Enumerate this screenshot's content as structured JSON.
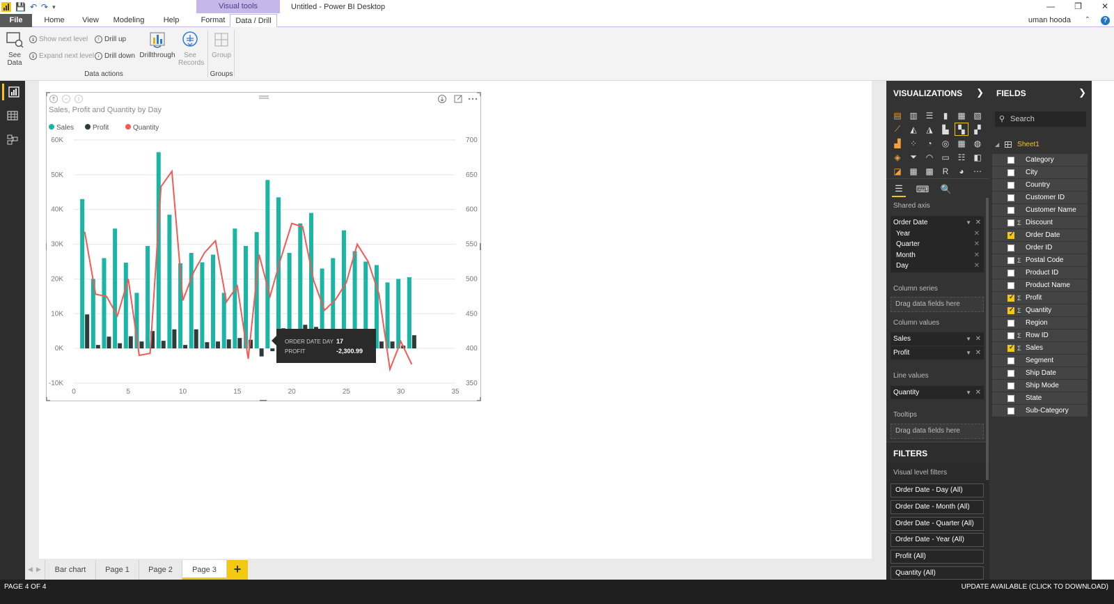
{
  "window": {
    "title": "Untitled - Power BI Desktop",
    "context_group": "Visual tools",
    "user": "uman hooda"
  },
  "tabs": [
    "File",
    "Home",
    "View",
    "Modeling",
    "Help",
    "Format",
    "Data / Drill"
  ],
  "ribbon": {
    "see_data": "See Data",
    "show_next_level": "Show next level",
    "expand_next_level": "Expand next level",
    "drill_up": "Drill up",
    "drill_down": "Drill down",
    "drillthrough": "Drillthrough",
    "see_records": "See Records",
    "group": "Group",
    "group_data_actions": "Data actions",
    "group_groups": "Groups"
  },
  "chart_data": {
    "type": "bar",
    "title": "Sales, Profit and Quantity by Day",
    "legend": [
      "Sales",
      "Profit",
      "Quantity"
    ],
    "legend_position": "top-left",
    "colors": {
      "Sales": "#1ab5a5",
      "Profit": "#2f3a3a",
      "Quantity": "#f25a55"
    },
    "x": [
      1,
      2,
      3,
      4,
      5,
      6,
      7,
      8,
      9,
      10,
      11,
      12,
      13,
      14,
      15,
      16,
      17,
      18,
      19,
      20,
      21,
      22,
      23,
      24,
      25,
      26,
      27,
      28,
      29,
      30,
      31
    ],
    "series": [
      {
        "name": "Sales",
        "axis": "left",
        "values": [
          43000,
          20000,
          26000,
          34500,
          24700,
          16000,
          29500,
          56500,
          38500,
          24500,
          27500,
          24800,
          27000,
          16000,
          34500,
          29500,
          33500,
          48500,
          43500,
          27500,
          36000,
          39000,
          23000,
          26000,
          34000,
          28000,
          25000,
          24000,
          19000,
          20000,
          20500
        ]
      },
      {
        "name": "Profit",
        "axis": "left",
        "values": [
          9800,
          1000,
          3400,
          1500,
          3500,
          2000,
          5000,
          2200,
          5500,
          1000,
          5500,
          1800,
          2000,
          2600,
          3000,
          2500,
          -2300.99,
          -800,
          5800,
          4000,
          6800,
          6200,
          5500,
          3500,
          3000,
          3000,
          2500,
          2000,
          2000,
          800,
          3800
        ]
      },
      {
        "name": "Quantity",
        "axis": "right",
        "values": [
          568,
          478,
          475,
          447,
          500,
          390,
          393,
          633,
          655,
          469,
          510,
          538,
          555,
          467,
          490,
          385,
          535,
          475,
          530,
          580,
          575,
          498,
          455,
          470,
          495,
          550,
          525,
          478,
          370,
          410,
          377
        ]
      }
    ],
    "ylim": [
      -10000,
      60000
    ],
    "yticks": [
      "-10K",
      "0K",
      "10K",
      "20K",
      "30K",
      "40K",
      "50K",
      "60K"
    ],
    "y2lim": [
      350,
      700
    ],
    "y2ticks": [
      "350",
      "400",
      "450",
      "500",
      "550",
      "600",
      "650",
      "700"
    ],
    "xlim": [
      0,
      35
    ],
    "xticks": [
      "0",
      "5",
      "10",
      "15",
      "20",
      "25",
      "30",
      "35"
    ],
    "grid": true
  },
  "tooltip": {
    "label1": "ORDER DATE DAY",
    "value1": "17",
    "label2": "PROFIT",
    "value2": "-2,300.99"
  },
  "page_tabs": [
    "Bar chart",
    "Page 1",
    "Page 2",
    "Page 3"
  ],
  "add_page": "+",
  "status": {
    "page": "PAGE 4 OF 4",
    "update": "UPDATE AVAILABLE (CLICK TO DOWNLOAD)"
  },
  "viz_pane": {
    "title": "VISUALIZATIONS",
    "shared_axis_label": "Shared axis",
    "shared_axis_field": "Order Date",
    "hierarchy": [
      "Year",
      "Quarter",
      "Month",
      "Day"
    ],
    "column_series_label": "Column series",
    "column_series_drop": "Drag data fields here",
    "column_values_label": "Column values",
    "column_values": [
      "Sales",
      "Profit"
    ],
    "line_values_label": "Line values",
    "line_values": [
      "Quantity"
    ],
    "tooltips_label": "Tooltips",
    "tooltips_drop": "Drag data fields here",
    "filters_title": "FILTERS",
    "visual_filters_label": "Visual level filters",
    "filters": [
      "Order Date - Day (All)",
      "Order Date - Month (All)",
      "Order Date - Quarter (All)",
      "Order Date - Year (All)",
      "Profit (All)",
      "Quantity (All)"
    ]
  },
  "fields_pane": {
    "title": "FIELDS",
    "search_placeholder": "Search",
    "table": "Sheet1",
    "fields": [
      {
        "name": "Category",
        "checked": false,
        "sigma": false
      },
      {
        "name": "City",
        "checked": false,
        "sigma": false
      },
      {
        "name": "Country",
        "checked": false,
        "sigma": false
      },
      {
        "name": "Customer ID",
        "checked": false,
        "sigma": false
      },
      {
        "name": "Customer Name",
        "checked": false,
        "sigma": false
      },
      {
        "name": "Discount",
        "checked": false,
        "sigma": true
      },
      {
        "name": "Order Date",
        "checked": true,
        "sigma": false
      },
      {
        "name": "Order ID",
        "checked": false,
        "sigma": false
      },
      {
        "name": "Postal Code",
        "checked": false,
        "sigma": true
      },
      {
        "name": "Product ID",
        "checked": false,
        "sigma": false
      },
      {
        "name": "Product Name",
        "checked": false,
        "sigma": false
      },
      {
        "name": "Profit",
        "checked": true,
        "sigma": true
      },
      {
        "name": "Quantity",
        "checked": true,
        "sigma": true
      },
      {
        "name": "Region",
        "checked": false,
        "sigma": false
      },
      {
        "name": "Row ID",
        "checked": false,
        "sigma": true
      },
      {
        "name": "Sales",
        "checked": true,
        "sigma": true
      },
      {
        "name": "Segment",
        "checked": false,
        "sigma": false
      },
      {
        "name": "Ship Date",
        "checked": false,
        "sigma": false
      },
      {
        "name": "Ship Mode",
        "checked": false,
        "sigma": false
      },
      {
        "name": "State",
        "checked": false,
        "sigma": false
      },
      {
        "name": "Sub-Category",
        "checked": false,
        "sigma": false
      }
    ]
  }
}
